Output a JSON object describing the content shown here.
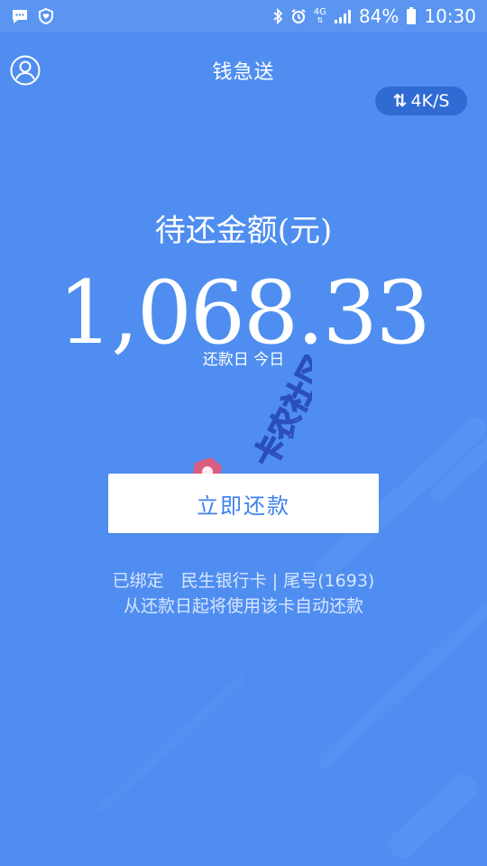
{
  "status_bar": {
    "battery_percent": "84%",
    "time": "10:30",
    "network": "4G",
    "icons": [
      "chat-icon",
      "shield-heart-icon",
      "bluetooth-icon",
      "alarm-icon",
      "signal-icon",
      "battery-icon"
    ]
  },
  "header": {
    "title": "钱急送",
    "speed": "4K/S"
  },
  "amount": {
    "label": "待还金额(元)",
    "value": "1,068.33",
    "repay_date": "还款日 今日"
  },
  "repay_button": {
    "label": "立即还款"
  },
  "card": {
    "bound": "已绑定　民生银行卡 | 尾号(1693)",
    "auto_repay": "从还款日起将使用该卡自动还款"
  },
  "watermark": {
    "text": "卡农社区"
  },
  "colors": {
    "background": "#4f8ef0",
    "button_text": "#3f82ee",
    "speed_badge": "#2f6bd2"
  }
}
